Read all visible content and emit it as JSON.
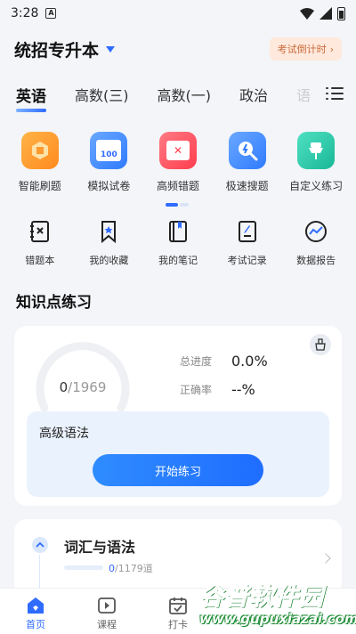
{
  "status_bar": {
    "time": "3:28",
    "notification_glyph": "A"
  },
  "header": {
    "title": "统招专升本",
    "countdown_label": "考试倒计时"
  },
  "tabs": [
    {
      "label": "英语",
      "active": true
    },
    {
      "label": "高数(三)"
    },
    {
      "label": "高数(一)"
    },
    {
      "label": "政治"
    },
    {
      "label": "语"
    }
  ],
  "features": [
    {
      "label": "智能刷题",
      "icon": "smart-practice-icon",
      "color": "#ff9a2e"
    },
    {
      "label": "模拟试卷",
      "icon": "mock-exam-icon",
      "color": "#3d8bff",
      "badge": "100"
    },
    {
      "label": "高频错题",
      "icon": "frequent-errors-icon",
      "color": "#ff4d5a"
    },
    {
      "label": "极速搜题",
      "icon": "quick-search-icon",
      "color": "#3d8bff"
    },
    {
      "label": "自定义练习",
      "icon": "custom-practice-icon",
      "color": "#22c7a9"
    }
  ],
  "tools": [
    {
      "label": "错题本",
      "icon": "error-book-icon"
    },
    {
      "label": "我的收藏",
      "icon": "favorites-icon"
    },
    {
      "label": "我的笔记",
      "icon": "notes-icon"
    },
    {
      "label": "考试记录",
      "icon": "exam-record-icon"
    },
    {
      "label": "数据报告",
      "icon": "data-report-icon"
    }
  ],
  "section_title": "知识点练习",
  "practice": {
    "done": "0",
    "total": "/1969",
    "progress_label": "总进度",
    "progress_value": "0.0%",
    "accuracy_label": "正确率",
    "accuracy_value": "--%",
    "topic": "高级语法",
    "start_label": "开始练习"
  },
  "chapter": {
    "title": "词汇与语法",
    "done": "0",
    "total": "/1179道"
  },
  "bottom_nav": [
    {
      "label": "首页",
      "icon": "home-icon",
      "active": true
    },
    {
      "label": "课程",
      "icon": "course-icon"
    },
    {
      "label": "打卡",
      "icon": "checkin-icon"
    }
  ],
  "watermark": {
    "title": "谷普软件园",
    "url": "www.gupuxiazai.com"
  },
  "colors": {
    "accent": "#2f6bff",
    "watermark_green": "#2db54a"
  }
}
